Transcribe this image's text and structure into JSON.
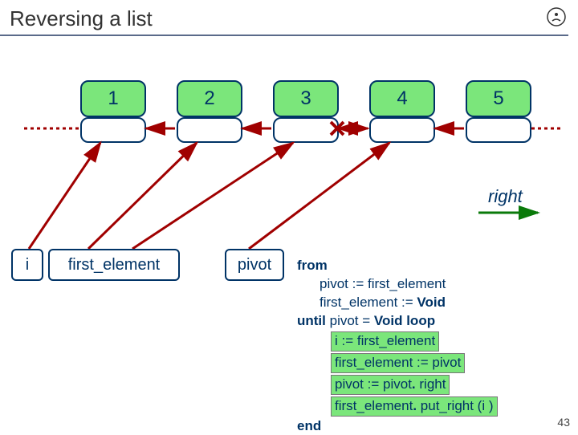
{
  "title": "Reversing a list",
  "nodes": [
    "1",
    "2",
    "3",
    "4",
    "5"
  ],
  "vars": {
    "i": "i",
    "first": "first_element",
    "pivot": "pivot"
  },
  "right_label": "right",
  "code": {
    "l1": "from",
    "l2": "pivot := first_element",
    "l3_a": "first_element := ",
    "l3_b": "Void",
    "l4_a": "until",
    "l4_b": " pivot = ",
    "l4_c": "Void",
    "l4_d": " loop",
    "l5": "i := first_element",
    "l6": "first_element := pivot",
    "l7_a": "pivot := pivot",
    "l7_b": "right",
    "l8_a": "first_element",
    "l8_b": "put_right (i )",
    "l9": "end"
  },
  "slide_number": "43"
}
